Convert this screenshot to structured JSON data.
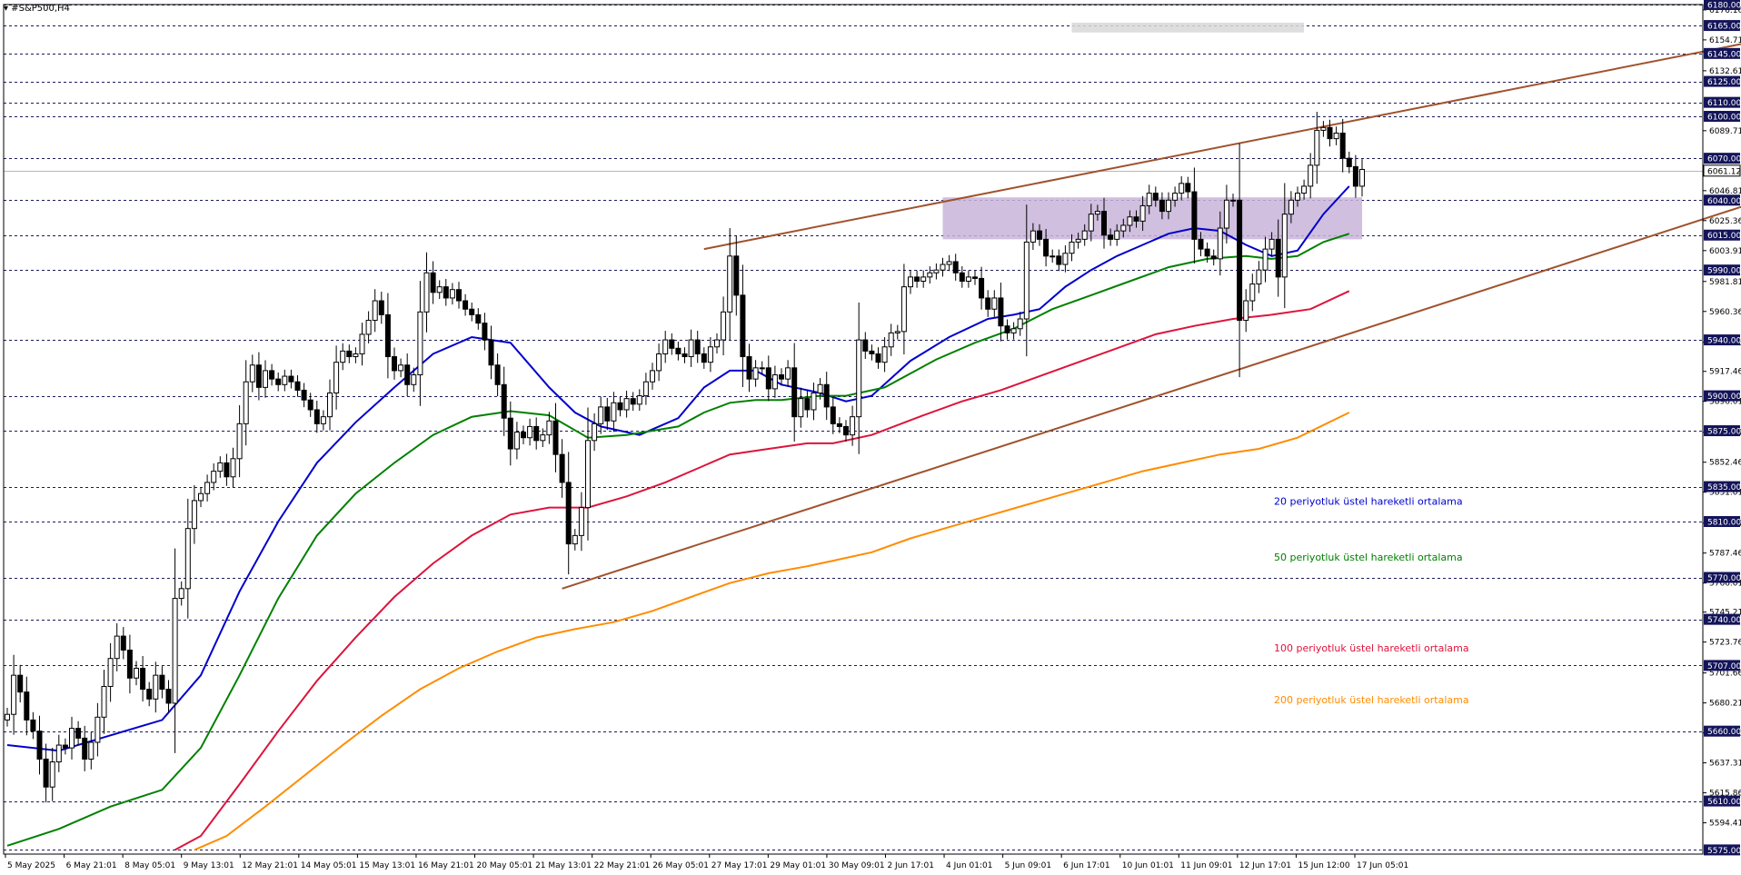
{
  "chart_data": {
    "type": "candlestick",
    "symbol": "#S&P500,H4",
    "timeframe": "H4",
    "ylim": [
      5572,
      6180
    ],
    "current_price": 6061.12,
    "price_axis_ticks": [
      6176.16,
      6154.71,
      6132.61,
      6089.71,
      6046.81,
      6025.36,
      6003.91,
      5981.81,
      5960.36,
      5938.26,
      5917.46,
      5896.01,
      5873.91,
      5852.46,
      5831.01,
      5808.91,
      5787.46,
      5766.01,
      5745.21,
      5723.76,
      5701.66,
      5680.21,
      5658.76,
      5637.31,
      5615.86,
      5594.41
    ],
    "horizontal_levels": [
      6180,
      6165,
      6145,
      6125,
      6110,
      6100,
      6070,
      6040,
      6015,
      5990,
      5940,
      5900,
      5875,
      5835,
      5810,
      5770,
      5740,
      5707,
      5660,
      5610,
      5575
    ],
    "time_axis_labels": [
      "5 May 2025",
      "6 May 21:01",
      "8 May 05:01",
      "9 May 13:01",
      "12 May 21:01",
      "14 May 05:01",
      "15 May 13:01",
      "16 May 21:01",
      "20 May 05:01",
      "21 May 13:01",
      "22 May 21:01",
      "26 May 05:01",
      "27 May 17:01",
      "29 May 01:01",
      "30 May 09:01",
      "2 Jun 17:01",
      "4 Jun 01:01",
      "5 Jun 09:01",
      "6 Jun 17:01",
      "10 Jun 01:01",
      "11 Jun 09:01",
      "12 Jun 17:01",
      "15 Jun 12:00",
      "17 Jun 05:01"
    ],
    "candle_closes": [
      5672,
      5700,
      5688,
      5668,
      5660,
      5640,
      5620,
      5638,
      5650,
      5648,
      5662,
      5655,
      5640,
      5652,
      5670,
      5692,
      5712,
      5728,
      5718,
      5698,
      5705,
      5690,
      5683,
      5700,
      5690,
      5680,
      5755,
      5762,
      5805,
      5825,
      5830,
      5838,
      5846,
      5852,
      5842,
      5855,
      5880,
      5910,
      5922,
      5906,
      5918,
      5912,
      5908,
      5914,
      5910,
      5904,
      5897,
      5890,
      5880,
      5885,
      5902,
      5924,
      5932,
      5928,
      5930,
      5944,
      5954,
      5968,
      5958,
      5928,
      5918,
      5922,
      5908,
      5915,
      5960,
      5988,
      5974,
      5978,
      5970,
      5976,
      5968,
      5962,
      5958,
      5952,
      5940,
      5922,
      5908,
      5884,
      5862,
      5874,
      5870,
      5878,
      5868,
      5872,
      5882,
      5858,
      5838,
      5794,
      5800,
      5820,
      5868,
      5880,
      5892,
      5882,
      5895,
      5890,
      5898,
      5894,
      5900,
      5910,
      5918,
      5930,
      5940,
      5934,
      5930,
      5928,
      5940,
      5930,
      5924,
      5935,
      5940,
      5960,
      6000,
      5972,
      5928,
      5912,
      5920,
      5920,
      5905,
      5915,
      5912,
      5920,
      5885,
      5898,
      5890,
      5902,
      5908,
      5892,
      5880,
      5878,
      5872,
      5885,
      5940,
      5932,
      5930,
      5924,
      5935,
      5945,
      5946,
      5978,
      5985,
      5982,
      5985,
      5988,
      5990,
      5994,
      5996,
      5988,
      5982,
      5985,
      5984,
      5970,
      5962,
      5970,
      5950,
      5945,
      5948,
      5955,
      6010,
      6018,
      6012,
      6000,
      6000,
      5994,
      6002,
      6010,
      6012,
      6018,
      6030,
      6032,
      6015,
      6012,
      6018,
      6022,
      6028,
      6025,
      6036,
      6045,
      6040,
      6032,
      6040,
      6045,
      6052,
      6046,
      6012,
      6005,
      6000,
      5998,
      6020,
      6040,
      6040,
      5954,
      5968,
      5980,
      5990,
      6005,
      6012,
      5985,
      6030,
      6040,
      6045,
      6050,
      6065,
      6090,
      6092,
      6084,
      6088,
      6070,
      6064,
      6050,
      6062
    ],
    "ema_series": [
      {
        "name": "20 periyotluk üstel hareketli ortalama",
        "color": "#0000cd",
        "points": [
          [
            0,
            5650
          ],
          [
            8,
            5646
          ],
          [
            16,
            5657
          ],
          [
            24,
            5668
          ],
          [
            30,
            5700
          ],
          [
            36,
            5760
          ],
          [
            42,
            5810
          ],
          [
            48,
            5852
          ],
          [
            54,
            5881
          ],
          [
            60,
            5906
          ],
          [
            66,
            5930
          ],
          [
            72,
            5942
          ],
          [
            78,
            5938
          ],
          [
            84,
            5906
          ],
          [
            88,
            5888
          ],
          [
            92,
            5878
          ],
          [
            98,
            5872
          ],
          [
            104,
            5884
          ],
          [
            108,
            5906
          ],
          [
            112,
            5918
          ],
          [
            116,
            5918
          ],
          [
            120,
            5908
          ],
          [
            126,
            5902
          ],
          [
            130,
            5896
          ],
          [
            134,
            5900
          ],
          [
            140,
            5925
          ],
          [
            146,
            5942
          ],
          [
            152,
            5955
          ],
          [
            156,
            5958
          ],
          [
            160,
            5962
          ],
          [
            164,
            5978
          ],
          [
            168,
            5990
          ],
          [
            172,
            6000
          ],
          [
            176,
            6008
          ],
          [
            180,
            6016
          ],
          [
            184,
            6020
          ],
          [
            188,
            6018
          ],
          [
            192,
            6008
          ],
          [
            196,
            6000
          ],
          [
            200,
            6004
          ],
          [
            204,
            6030
          ],
          [
            208,
            6050
          ]
        ]
      },
      {
        "name": "50 periyotluk üstel hareketli ortalama",
        "color": "#008000",
        "points": [
          [
            0,
            5578
          ],
          [
            8,
            5590
          ],
          [
            16,
            5606
          ],
          [
            24,
            5618
          ],
          [
            30,
            5648
          ],
          [
            36,
            5700
          ],
          [
            42,
            5755
          ],
          [
            48,
            5800
          ],
          [
            54,
            5830
          ],
          [
            60,
            5852
          ],
          [
            66,
            5872
          ],
          [
            72,
            5885
          ],
          [
            78,
            5889
          ],
          [
            84,
            5886
          ],
          [
            90,
            5870
          ],
          [
            96,
            5872
          ],
          [
            104,
            5878
          ],
          [
            108,
            5888
          ],
          [
            112,
            5895
          ],
          [
            116,
            5897
          ],
          [
            120,
            5897
          ],
          [
            126,
            5900
          ],
          [
            130,
            5900
          ],
          [
            136,
            5906
          ],
          [
            144,
            5926
          ],
          [
            150,
            5938
          ],
          [
            156,
            5948
          ],
          [
            162,
            5962
          ],
          [
            168,
            5972
          ],
          [
            174,
            5982
          ],
          [
            180,
            5992
          ],
          [
            186,
            5998
          ],
          [
            192,
            6000
          ],
          [
            196,
            5998
          ],
          [
            200,
            6000
          ],
          [
            204,
            6010
          ],
          [
            208,
            6016
          ]
        ]
      },
      {
        "name": "100 periyotluk üstel hareketli ortalama",
        "color": "#dc143c",
        "points": [
          [
            26,
            5575
          ],
          [
            30,
            5585
          ],
          [
            36,
            5622
          ],
          [
            42,
            5660
          ],
          [
            48,
            5696
          ],
          [
            54,
            5727
          ],
          [
            60,
            5756
          ],
          [
            66,
            5780
          ],
          [
            72,
            5800
          ],
          [
            78,
            5815
          ],
          [
            84,
            5820
          ],
          [
            90,
            5820
          ],
          [
            96,
            5828
          ],
          [
            102,
            5838
          ],
          [
            108,
            5850
          ],
          [
            112,
            5858
          ],
          [
            118,
            5862
          ],
          [
            124,
            5866
          ],
          [
            128,
            5866
          ],
          [
            134,
            5872
          ],
          [
            142,
            5886
          ],
          [
            148,
            5896
          ],
          [
            154,
            5904
          ],
          [
            160,
            5914
          ],
          [
            166,
            5924
          ],
          [
            172,
            5934
          ],
          [
            178,
            5944
          ],
          [
            184,
            5950
          ],
          [
            190,
            5955
          ],
          [
            196,
            5958
          ],
          [
            202,
            5962
          ],
          [
            208,
            5975
          ]
        ]
      },
      {
        "name": "200 periyotluk üstel hareketli ortalama",
        "color": "#ff8c00",
        "points": [
          [
            29,
            5575
          ],
          [
            34,
            5585
          ],
          [
            40,
            5606
          ],
          [
            46,
            5628
          ],
          [
            52,
            5650
          ],
          [
            58,
            5671
          ],
          [
            64,
            5690
          ],
          [
            70,
            5705
          ],
          [
            76,
            5717
          ],
          [
            82,
            5727
          ],
          [
            88,
            5733
          ],
          [
            94,
            5738
          ],
          [
            100,
            5746
          ],
          [
            106,
            5756
          ],
          [
            112,
            5766
          ],
          [
            118,
            5773
          ],
          [
            124,
            5778
          ],
          [
            128,
            5782
          ],
          [
            134,
            5788
          ],
          [
            140,
            5798
          ],
          [
            146,
            5806
          ],
          [
            152,
            5814
          ],
          [
            158,
            5822
          ],
          [
            164,
            5830
          ],
          [
            170,
            5838
          ],
          [
            176,
            5846
          ],
          [
            182,
            5852
          ],
          [
            188,
            5858
          ],
          [
            194,
            5862
          ],
          [
            200,
            5870
          ],
          [
            208,
            5888
          ]
        ]
      }
    ],
    "trendlines": [
      {
        "color": "#a0522d",
        "from": [
          86,
          5762
        ],
        "to": [
          280,
          6052
        ]
      },
      {
        "color": "#a0522d",
        "from": [
          108,
          6005
        ],
        "to": [
          280,
          6162
        ]
      }
    ],
    "zones": [
      {
        "color": "#c8b4d8",
        "x0": 145,
        "x1": 210,
        "y0": 6012,
        "y1": 6042
      },
      {
        "color": "#d8d8d8",
        "x0": 165,
        "x1": 201,
        "y0": 6160,
        "y1": 6167
      }
    ]
  }
}
